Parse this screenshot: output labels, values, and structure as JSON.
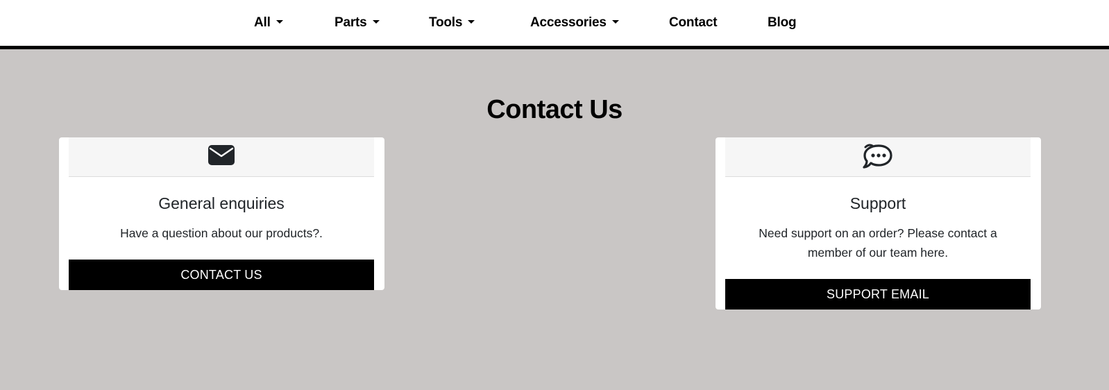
{
  "nav": {
    "items": [
      {
        "label": "All"
      },
      {
        "label": "Parts"
      },
      {
        "label": "Tools"
      },
      {
        "label": "Accessories"
      },
      {
        "label": "Contact"
      },
      {
        "label": "Blog"
      }
    ]
  },
  "main": {
    "title": "Contact Us",
    "cards": [
      {
        "icon": "envelope-icon",
        "title": "General enquiries",
        "text": "Have a question about our products?.",
        "button": "CONTACT US"
      },
      {
        "icon": "chat-bubble-icon",
        "title": "Support",
        "text": "Need support on an order? Please contact a member of our team here.",
        "button": "SUPPORT EMAIL"
      }
    ]
  },
  "colors": {
    "background": "#c9c6c5",
    "nav_background": "#ffffff",
    "nav_border": "#000000",
    "button": "#000000",
    "card_header": "#f6f6f6"
  }
}
